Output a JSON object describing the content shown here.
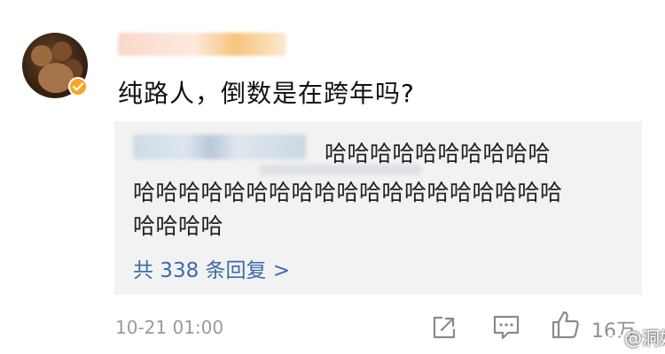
{
  "post": {
    "comment_text": "纯路人，倒数是在跨年吗?",
    "timestamp": "10-21 01:00",
    "like_count": "16万"
  },
  "reply": {
    "lines": [
      "哈哈哈哈哈哈哈哈哈哈",
      "哈哈哈哈哈哈哈哈哈哈哈哈哈哈哈哈哈哈哈",
      "哈哈哈哈"
    ],
    "more_link": "共 338 条回复 >"
  },
  "watermark": {
    "text": "@洞娱"
  },
  "icons": {
    "avatar_badge": "verified-badge-icon",
    "share": "share-icon",
    "comment": "comment-icon",
    "like": "thumbs-up-icon",
    "watermark_logo": "weibo-logo-icon"
  },
  "colors": {
    "link": "#3d6aa8",
    "badge": "#f6a623",
    "reply_background": "#f2f2f2",
    "muted_text": "#9a9a9a"
  }
}
